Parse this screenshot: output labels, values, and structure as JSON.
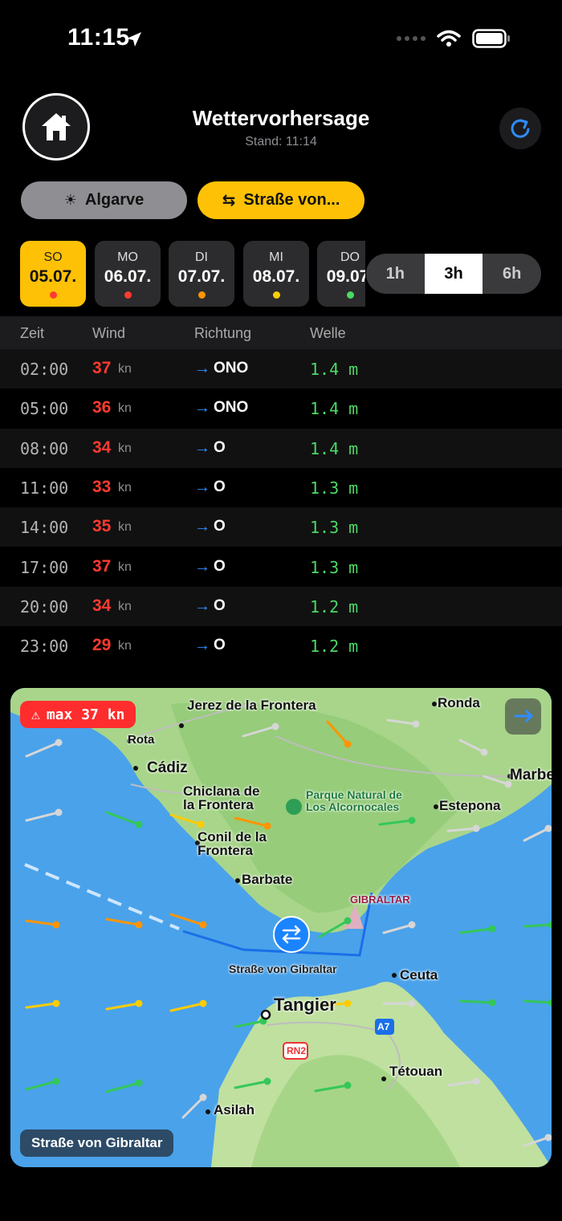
{
  "status_bar": {
    "time": "11:15"
  },
  "header": {
    "title": "Wettervorhersage",
    "subtitle": "Stand: 11:14"
  },
  "locations": [
    {
      "label": "Algarve",
      "icon": "sun-icon",
      "selected": false
    },
    {
      "label": "Straße von...",
      "icon": "arrows-swap-icon",
      "selected": true
    }
  ],
  "days": [
    {
      "weekday": "SO",
      "date": "05.07.",
      "dot": "#ff3b30",
      "selected": true
    },
    {
      "weekday": "MO",
      "date": "06.07.",
      "dot": "#ff3b30",
      "selected": false
    },
    {
      "weekday": "DI",
      "date": "07.07.",
      "dot": "#ff9500",
      "selected": false
    },
    {
      "weekday": "MI",
      "date": "08.07.",
      "dot": "#ffcc00",
      "selected": false
    },
    {
      "weekday": "DO",
      "date": "09.07.",
      "dot": "#4cd964",
      "selected": false
    }
  ],
  "intervals": [
    "1h",
    "3h",
    "6h"
  ],
  "interval_selected": "3h",
  "table": {
    "headers": {
      "time": "Zeit",
      "wind": "Wind",
      "direction": "Richtung",
      "wave": "Welle"
    },
    "rows": [
      {
        "time": "02:00",
        "wind": "37",
        "unit": "kn",
        "arrow": "→",
        "direction": "ONO",
        "wave": "1.4 m"
      },
      {
        "time": "05:00",
        "wind": "36",
        "unit": "kn",
        "arrow": "→",
        "direction": "ONO",
        "wave": "1.4 m"
      },
      {
        "time": "08:00",
        "wind": "34",
        "unit": "kn",
        "arrow": "→",
        "direction": "O",
        "wave": "1.4 m"
      },
      {
        "time": "11:00",
        "wind": "33",
        "unit": "kn",
        "arrow": "→",
        "direction": "O",
        "wave": "1.3 m"
      },
      {
        "time": "14:00",
        "wind": "35",
        "unit": "kn",
        "arrow": "→",
        "direction": "O",
        "wave": "1.3 m"
      },
      {
        "time": "17:00",
        "wind": "37",
        "unit": "kn",
        "arrow": "→",
        "direction": "O",
        "wave": "1.3 m"
      },
      {
        "time": "20:00",
        "wind": "34",
        "unit": "kn",
        "arrow": "→",
        "direction": "O",
        "wave": "1.2 m"
      },
      {
        "time": "23:00",
        "wind": "29",
        "unit": "kn",
        "arrow": "→",
        "direction": "O",
        "wave": "1.2 m"
      }
    ]
  },
  "map": {
    "max_badge": "max 37 kn",
    "region_label": "Straße von Gibraltar",
    "places": [
      "Jerez de la Frontera",
      "Ronda",
      "Rota",
      "Cádiz",
      "Marbe",
      "Chiclana de la Frontera",
      "Parque Natural de Los Alcornocales",
      "Estepona",
      "Conil de la Frontera",
      "Barbate",
      "GIBRALTAR",
      "Straße von Gibraltar",
      "Ceuta",
      "Tangier",
      "A7",
      "RN2",
      "Tétouan",
      "Asilah"
    ],
    "colors": {
      "red": "#ff3b30",
      "orange": "#ff9500",
      "yellow": "#ffcc00",
      "green": "#34c759",
      "gray": "#d0d0d0"
    }
  }
}
